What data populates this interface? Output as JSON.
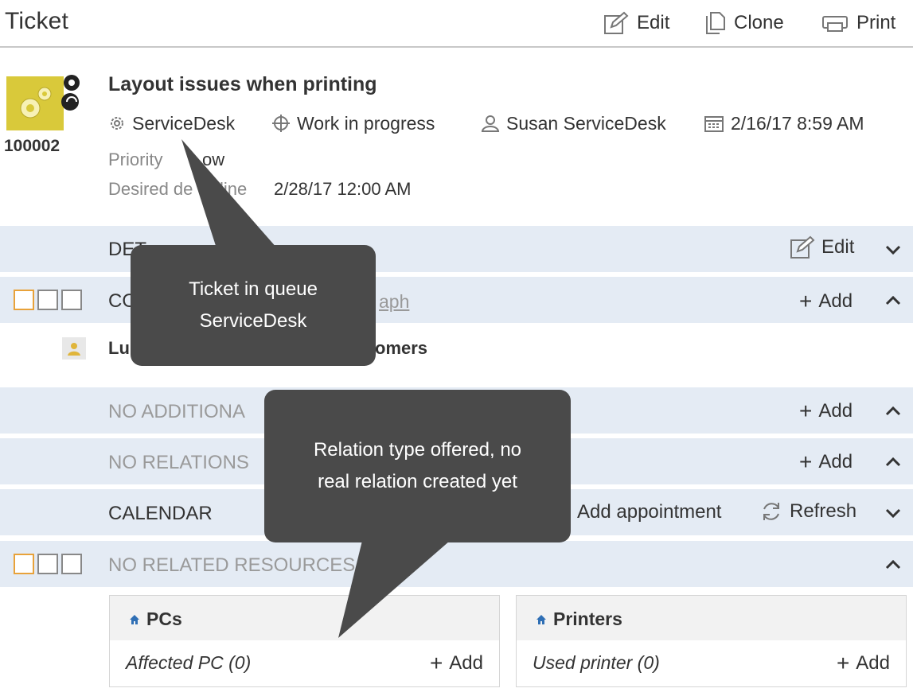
{
  "header": {
    "title": "Ticket",
    "edit_label": "Edit",
    "clone_label": "Clone",
    "print_label": "Print"
  },
  "ticket": {
    "id": "100002",
    "title": "Layout issues when printing",
    "queue": "ServiceDesk",
    "status": "Work in progress",
    "agent": "Susan ServiceDesk",
    "date": "2/16/17 8:59 AM",
    "priority_label": "Priority",
    "priority_value": "ow",
    "deadline_label_a": "Desired de",
    "deadline_label_b": "line",
    "deadline_value": "2/28/17 12:00 AM"
  },
  "sections": {
    "details": {
      "title": "DET",
      "edit_label": "Edit"
    },
    "contacts": {
      "title": "CO",
      "graph_fragment": "aph",
      "add_label": "Add"
    },
    "contact_row": {
      "name_fragment": "Lul",
      "org_fragment": "omers"
    },
    "additional": {
      "title": "NO ADDITIONA",
      "add_label": "Add"
    },
    "relations": {
      "title": "NO RELATIONS",
      "add_label": "Add"
    },
    "calendar": {
      "title": "CALENDAR",
      "appointment_label": "Add appointment",
      "refresh_label": "Refresh"
    },
    "resources": {
      "title": "NO RELATED RESOURCES"
    }
  },
  "cards": [
    {
      "title": "PCs",
      "relation": "Affected PC (0)",
      "add_label": "Add"
    },
    {
      "title": "Printers",
      "relation": "Used printer (0)",
      "add_label": "Add"
    }
  ],
  "callouts": {
    "queue": {
      "line1": "Ticket in queue",
      "line2": "ServiceDesk"
    },
    "relation": {
      "line1": "Relation type offered, no",
      "line2": "real relation created yet"
    }
  },
  "colors": {
    "section_bg": "#e4ebf4",
    "callout_bg": "#4a4a4a",
    "logo_yellow": "#d9c93a",
    "accent_orange": "#e8a23a",
    "home_icon_blue": "#2f6fb5"
  },
  "icons": {
    "edit": "edit-icon",
    "clone": "clone-icon",
    "print": "print-icon",
    "queue": "gear-icon",
    "status": "status-icon",
    "agent": "user-icon",
    "date": "calendar-icon",
    "add": "plus-icon",
    "refresh": "refresh-icon",
    "collapse": "chevron-up-icon",
    "expand": "chevron-down-icon",
    "home": "home-icon",
    "contact": "person-icon"
  }
}
